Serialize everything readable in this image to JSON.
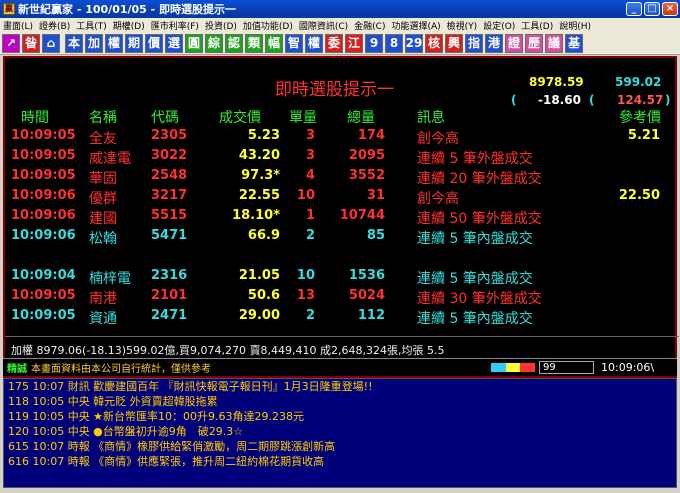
{
  "titlebar": {
    "app_title": "新世紀贏家 - 100/01/05 - 即時選股提示一",
    "min": "_",
    "max": "□",
    "close": "×"
  },
  "menu": [
    "畫面(L)",
    "證券(B)",
    "工具(T)",
    "期權(D)",
    "匯市利率(F)",
    "投資(D)",
    "加值功能(D)",
    "國際資訊(C)",
    "金融(C)",
    "功能選擇(A)",
    "檢視(Y)",
    "設定(O)",
    "工具(D)",
    "說明(H)"
  ],
  "toolbar": [
    {
      "label": "↗",
      "bg": "#c000c0"
    },
    {
      "label": "昝",
      "bg": "#d42020"
    },
    {
      "label": "⌂",
      "bg": "#2050d0",
      "sep": true
    },
    {
      "label": "本",
      "bg": "#2050d0"
    },
    {
      "label": "加",
      "bg": "#2050d0"
    },
    {
      "label": "權",
      "bg": "#2050d0"
    },
    {
      "label": "期",
      "bg": "#2050d0"
    },
    {
      "label": "價",
      "bg": "#2050d0"
    },
    {
      "label": "選",
      "bg": "#2050d0"
    },
    {
      "label": "圓",
      "bg": "#20a020"
    },
    {
      "label": "綜",
      "bg": "#20a020"
    },
    {
      "label": "認",
      "bg": "#20a020"
    },
    {
      "label": "類",
      "bg": "#20a020"
    },
    {
      "label": "幅",
      "bg": "#20a020"
    },
    {
      "label": "智",
      "bg": "#2050d0"
    },
    {
      "label": "權",
      "bg": "#2050d0"
    },
    {
      "label": "委",
      "bg": "#d42020"
    },
    {
      "label": "江",
      "bg": "#d42020"
    },
    {
      "label": "9",
      "bg": "#2050d0"
    },
    {
      "label": "8",
      "bg": "#2050d0"
    },
    {
      "label": "29",
      "bg": "#2050d0"
    },
    {
      "label": "核",
      "bg": "#d42020"
    },
    {
      "label": "興",
      "bg": "#d42020"
    },
    {
      "label": "指",
      "bg": "#2050d0"
    },
    {
      "label": "港",
      "bg": "#2050d0"
    },
    {
      "label": "證",
      "bg": "#d050a0"
    },
    {
      "label": "歷",
      "bg": "#d050a0"
    },
    {
      "label": "議",
      "bg": "#d050a0"
    },
    {
      "label": "基",
      "bg": "#2050d0"
    }
  ],
  "panel": {
    "title": "即時選股提示一",
    "index_value": "8978.59",
    "index_change": "-18.60",
    "otc_value": "599.02",
    "otc_change": "124.57",
    "paren_open": "(",
    "paren_close": ")",
    "headers": {
      "time": "時間",
      "name": "名稱",
      "code": "代碼",
      "price": "成交價",
      "vol": "單量",
      "total": "總量",
      "msg": "訊息",
      "ref": "參考價"
    },
    "rows": [
      {
        "time": "10:09:05",
        "name": "全友",
        "code": "2305",
        "price": "5.23",
        "vol": "3",
        "total": "174",
        "msg": "創今高",
        "ref": "5.21",
        "tc": "#ff3030",
        "nc": "#ff3030",
        "mc": "#ff3030"
      },
      {
        "time": "10:09:05",
        "name": "威達電",
        "code": "3022",
        "price": "43.20",
        "vol": "3",
        "total": "2095",
        "msg": "連續 5 筆外盤成交",
        "ref": "",
        "tc": "#ff3030",
        "nc": "#ff3030",
        "mc": "#ff3030"
      },
      {
        "time": "10:09:05",
        "name": "華固",
        "code": "2548",
        "price": "97.3*",
        "vol": "4",
        "total": "3552",
        "msg": "連續 20 筆外盤成交",
        "ref": "",
        "tc": "#ff3030",
        "nc": "#ff3030",
        "mc": "#ff3030"
      },
      {
        "time": "10:09:06",
        "name": "優群",
        "code": "3217",
        "price": "22.55",
        "vol": "10",
        "total": "31",
        "msg": "創今高",
        "ref": "22.50",
        "tc": "#ff3030",
        "nc": "#ff3030",
        "mc": "#ff3030"
      },
      {
        "time": "10:09:06",
        "name": "建國",
        "code": "5515",
        "price": "18.10*",
        "vol": "1",
        "total": "10744",
        "msg": "連續 50 筆外盤成交",
        "ref": "",
        "tc": "#ff3030",
        "nc": "#ff3030",
        "mc": "#ff3030"
      },
      {
        "time": "10:09:06",
        "name": "松翰",
        "code": "5471",
        "price": "66.9",
        "vol": "2",
        "total": "85",
        "msg": "連續 5 筆內盤成交",
        "ref": "",
        "tc": "#33dddd",
        "nc": "#33dddd",
        "mc": "#33dddd"
      },
      {
        "time": "10:09:04",
        "name": "楠梓電",
        "code": "2316",
        "price": "21.05",
        "vol": "10",
        "total": "1536",
        "msg": "連續 5 筆內盤成交",
        "ref": "",
        "tc": "#33dddd",
        "nc": "#33dddd",
        "mc": "#33dddd"
      },
      {
        "time": "10:09:05",
        "name": "南港",
        "code": "2101",
        "price": "50.6",
        "vol": "13",
        "total": "5024",
        "msg": "連續 30 筆外盤成交",
        "ref": "",
        "tc": "#ff3030",
        "nc": "#ff3030",
        "mc": "#ff3030"
      },
      {
        "time": "10:09:05",
        "name": "資通",
        "code": "2471",
        "price": "29.00",
        "vol": "2",
        "total": "112",
        "msg": "連續 5 筆內盤成交",
        "ref": "",
        "tc": "#33dddd",
        "nc": "#33dddd",
        "mc": "#33dddd"
      }
    ],
    "status_line": "加權 8979.06(-18.13)599.02億,買9,074,270 賣8,449,410 成2,648,324張,均張 5.5"
  },
  "infobar": {
    "label": "精誠",
    "text": "本畫面資料由本公司自行統計，僅供參考",
    "page": "99",
    "clock": "10:09:06\\"
  },
  "news": [
    {
      "text": "175 10:07 財訊 歡慶建國百年 『財訊快報電子報日刊』1月3日隆重登場!!",
      "color": "#ffcc00"
    },
    {
      "text": "118 10:05 中央 韓元貶 外資賣超韓股拖累",
      "color": "#ffcc00"
    },
    {
      "text": "119 10:05 中央 ★新台幣匯率10：00升9.63角達29.238元",
      "color": "#ffcc00"
    },
    {
      "text": "120 10:05 中央 ●台幣盤初升逾9角　破29.3☆",
      "color": "#ffcc00"
    },
    {
      "text": "615 10:07 時報 《商情》橡膠供給緊俏激勵，周二期膠跳漲創新高",
      "color": "#ffcc00"
    },
    {
      "text": "616 10:07 時報 《商情》供應緊張，推升周二紐約棉花期貨收高",
      "color": "#ffcc00"
    }
  ],
  "colors": {
    "up": "#ff3030",
    "down": "#33dddd",
    "header": "#33ee33",
    "title": "#ff3333",
    "index": "#ffff33",
    "otc": "#33dddd",
    "otc_change": "#ff5555"
  }
}
